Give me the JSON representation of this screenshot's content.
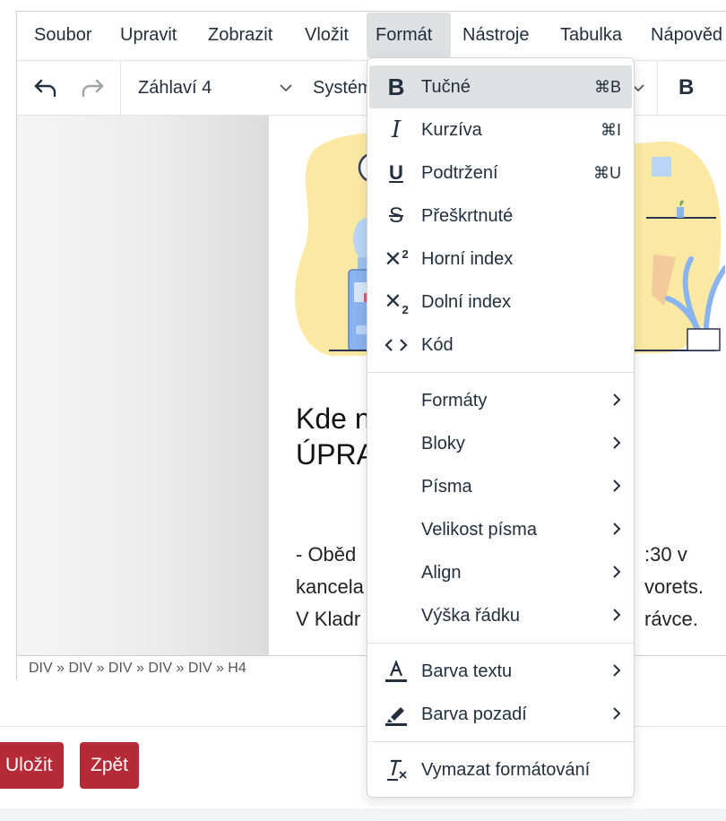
{
  "menubar": {
    "items": [
      "Soubor",
      "Upravit",
      "Zobrazit",
      "Vložit",
      "Formát",
      "Nástroje",
      "Tabulka",
      "Nápověd"
    ]
  },
  "toolbar": {
    "block_format": "Záhlaví 4",
    "font_family": "Systém"
  },
  "content": {
    "heading_line1": "Kde n",
    "heading_line2": "ÚPRA",
    "para_lines": [
      "- Oběd",
      "kancela",
      "V Kladr"
    ],
    "para_end_lines": [
      ":30 v",
      "vorets.",
      "rávce."
    ]
  },
  "statusbar": {
    "path": "DIV » DIV » DIV » DIV » DIV » H4"
  },
  "buttons": {
    "save": "Uložit",
    "back": "Zpět"
  },
  "format_menu": {
    "group1": [
      {
        "icon": "bold-icon",
        "label": "Tučné",
        "shortcut": "⌘B"
      },
      {
        "icon": "italic-icon",
        "label": "Kurzíva",
        "shortcut": "⌘I"
      },
      {
        "icon": "underline-icon",
        "label": "Podtržení",
        "shortcut": "⌘U"
      },
      {
        "icon": "strikethrough-icon",
        "label": "Přeškrtnuté",
        "shortcut": ""
      },
      {
        "icon": "superscript-icon",
        "label": "Horní index",
        "shortcut": ""
      },
      {
        "icon": "subscript-icon",
        "label": "Dolní index",
        "shortcut": ""
      },
      {
        "icon": "code-icon",
        "label": "Kód",
        "shortcut": ""
      }
    ],
    "group2": [
      {
        "label": "Formáty"
      },
      {
        "label": "Bloky"
      },
      {
        "label": "Písma"
      },
      {
        "label": "Velikost písma"
      },
      {
        "label": "Align"
      },
      {
        "label": "Výška řádku"
      }
    ],
    "group3": [
      {
        "icon": "text-color-icon",
        "label": "Barva textu"
      },
      {
        "icon": "highlighter-icon",
        "label": "Barva pozadí"
      }
    ],
    "group4": [
      {
        "icon": "remove-format-icon",
        "label": "Vymazat formátování"
      }
    ]
  },
  "colors": {
    "button_bg": "#b52a37",
    "menu_active_bg": "#dee0e2",
    "illustration_yellow": "#fbe9a3",
    "illustration_blue": "#8ab4f0"
  }
}
